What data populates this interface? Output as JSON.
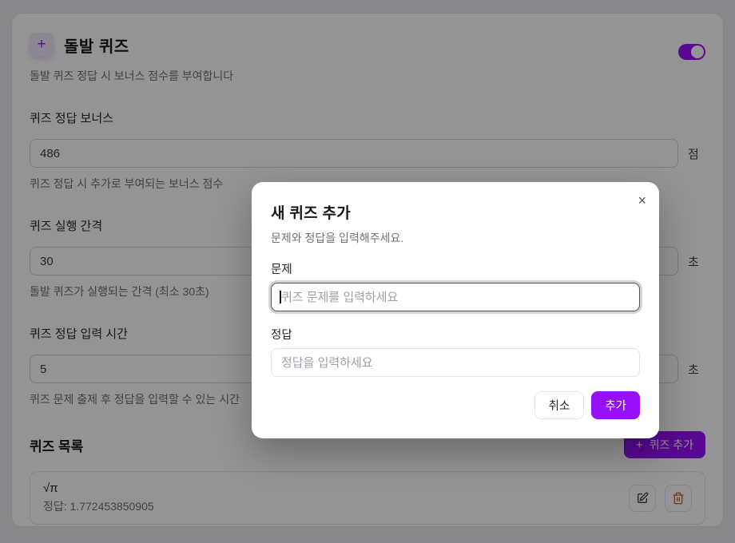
{
  "page": {
    "header": {
      "icon_glyph": "+",
      "title": "돌발 퀴즈",
      "subtitle": "돌발 퀴즈 정답 시 보너스 점수를 부여합니다",
      "toggle_state": "on"
    },
    "fields": [
      {
        "label": "퀴즈 정답 보너스",
        "value": "486",
        "unit": "점",
        "help": "퀴즈 정답 시 추가로 부여되는 보너스 점수"
      },
      {
        "label": "퀴즈 실행 간격",
        "value": "30",
        "unit": "초",
        "help": "돌발 퀴즈가 실행되는 간격 (최소 30초)"
      },
      {
        "label": "퀴즈 정답 입력 시간",
        "value": "5",
        "unit": "초",
        "help": "퀴즈 문제 출제 후 정답을 입력할 수 있는 시간"
      }
    ],
    "quiz_list": {
      "title": "퀴즈 목록",
      "add_icon": "+",
      "add_label": "퀴즈 추가",
      "items": [
        {
          "question": "√π",
          "answer": "정답: 1.772453850905"
        }
      ]
    }
  },
  "modal": {
    "title": "새 퀴즈 추가",
    "subtitle": "문제와 정답을 입력해주세요.",
    "close_glyph": "×",
    "question_label": "문제",
    "question_placeholder": "퀴즈 문제를 입력하세요",
    "answer_label": "정답",
    "answer_placeholder": "정답을 입력하세요",
    "cancel_label": "취소",
    "submit_label": "추가"
  },
  "colors": {
    "accent": "#9810fa",
    "accent_light": "#f3e8ff",
    "danger": "#c96442",
    "overlay": "rgba(0,0,0,0.42)"
  }
}
